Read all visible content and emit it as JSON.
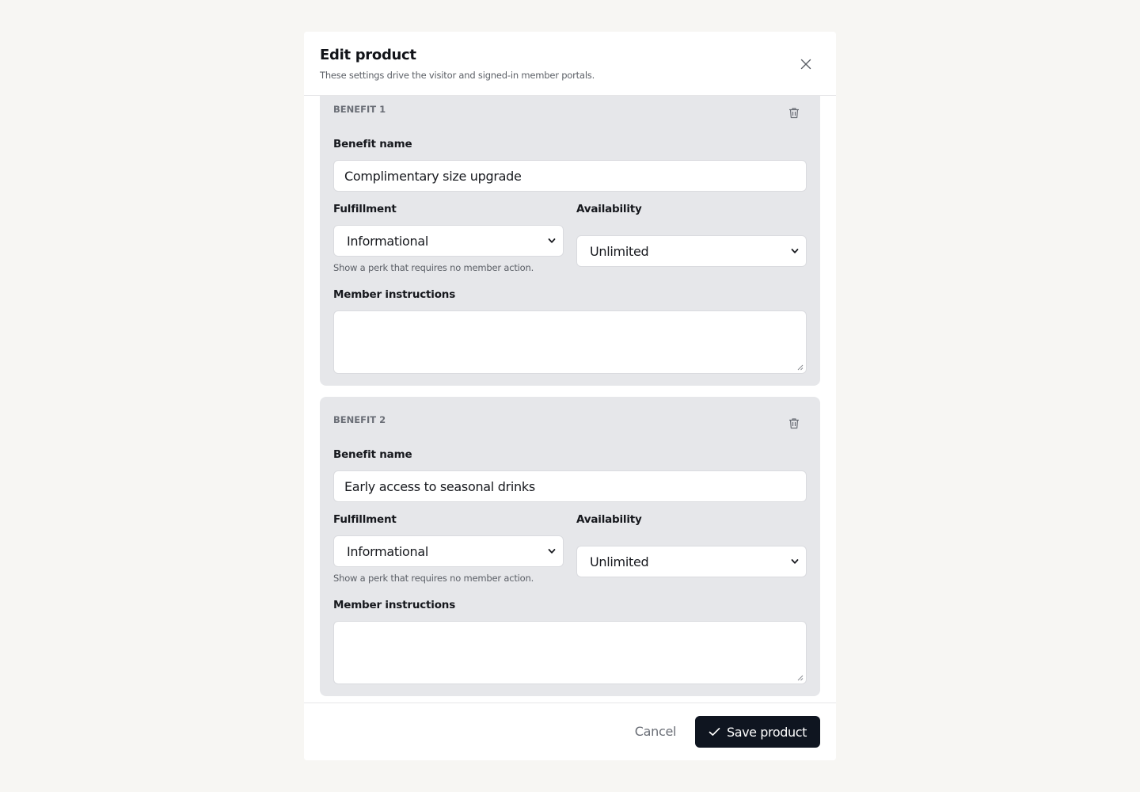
{
  "modal": {
    "title": "Edit product",
    "subtitle": "These settings drive the visitor and signed-in member portals."
  },
  "benefits": [
    {
      "heading": "BENEFIT 1",
      "name_label": "Benefit name",
      "name_value": "Complimentary size upgrade",
      "fulfillment_label": "Fulfillment",
      "fulfillment_value": "Informational",
      "fulfillment_help": "Show a perk that requires no member action.",
      "availability_label": "Availability",
      "availability_value": "Unlimited",
      "instructions_label": "Member instructions",
      "instructions_value": ""
    },
    {
      "heading": "BENEFIT 2",
      "name_label": "Benefit name",
      "name_value": "Early access to seasonal drinks",
      "fulfillment_label": "Fulfillment",
      "fulfillment_value": "Informational",
      "fulfillment_help": "Show a perk that requires no member action.",
      "availability_label": "Availability",
      "availability_value": "Unlimited",
      "instructions_label": "Member instructions",
      "instructions_value": ""
    }
  ],
  "footer": {
    "cancel_label": "Cancel",
    "save_label": "Save product"
  },
  "icons": {
    "close": "close-icon",
    "delete": "trash-icon",
    "dropdown": "chevron-down-icon",
    "save": "check-icon"
  },
  "colors": {
    "page_background": "#f7f6f3",
    "card_background": "#e6e7ea",
    "primary_button": "#0f1520"
  }
}
